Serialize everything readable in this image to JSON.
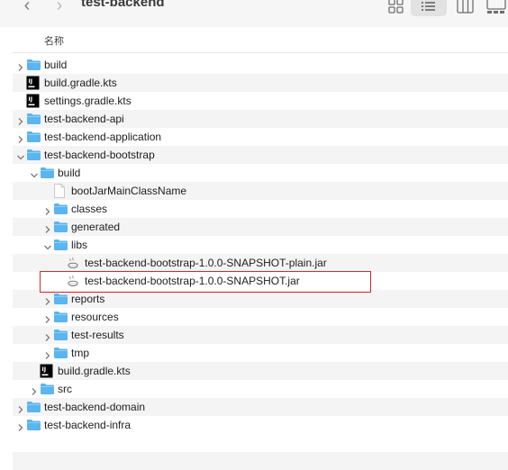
{
  "toolbar": {
    "back_glyph": "‹",
    "forward_glyph": "›",
    "title": "test-backend",
    "views": [
      {
        "name": "icon-view",
        "icon": "grid-icon"
      },
      {
        "name": "list-view",
        "icon": "list-icon",
        "selected": true
      },
      {
        "name": "column-view",
        "icon": "columns-icon"
      },
      {
        "name": "gallery-view",
        "icon": "gallery-icon"
      }
    ]
  },
  "header": {
    "name_column": "名称"
  },
  "colors": {
    "folder": "#5ab5f0",
    "selection_outline": "#d8272b",
    "alt_row": "#f4f4f5"
  },
  "files": [
    {
      "name": "build",
      "depth": 0,
      "kind": "folder",
      "disclosure": "collapsed"
    },
    {
      "name": "build.gradle.kts",
      "depth": 0,
      "kind": "intellij-file"
    },
    {
      "name": "settings.gradle.kts",
      "depth": 0,
      "kind": "intellij-file"
    },
    {
      "name": "test-backend-api",
      "depth": 0,
      "kind": "folder",
      "disclosure": "collapsed"
    },
    {
      "name": "test-backend-application",
      "depth": 0,
      "kind": "folder",
      "disclosure": "collapsed"
    },
    {
      "name": "test-backend-bootstrap",
      "depth": 0,
      "kind": "folder",
      "disclosure": "expanded"
    },
    {
      "name": "build",
      "depth": 1,
      "kind": "folder",
      "disclosure": "expanded"
    },
    {
      "name": "bootJarMainClassName",
      "depth": 2,
      "kind": "document"
    },
    {
      "name": "classes",
      "depth": 2,
      "kind": "folder",
      "disclosure": "collapsed"
    },
    {
      "name": "generated",
      "depth": 2,
      "kind": "folder",
      "disclosure": "collapsed"
    },
    {
      "name": "libs",
      "depth": 2,
      "kind": "folder",
      "disclosure": "expanded"
    },
    {
      "name": "test-backend-bootstrap-1.0.0-SNAPSHOT-plain.jar",
      "depth": 3,
      "kind": "jar-file"
    },
    {
      "name": "test-backend-bootstrap-1.0.0-SNAPSHOT.jar",
      "depth": 3,
      "kind": "jar-file",
      "highlighted": true
    },
    {
      "name": "reports",
      "depth": 2,
      "kind": "folder",
      "disclosure": "collapsed"
    },
    {
      "name": "resources",
      "depth": 2,
      "kind": "folder",
      "disclosure": "collapsed"
    },
    {
      "name": "test-results",
      "depth": 2,
      "kind": "folder",
      "disclosure": "collapsed"
    },
    {
      "name": "tmp",
      "depth": 2,
      "kind": "folder",
      "disclosure": "collapsed"
    },
    {
      "name": "build.gradle.kts",
      "depth": 1,
      "kind": "intellij-file"
    },
    {
      "name": "src",
      "depth": 1,
      "kind": "folder",
      "disclosure": "collapsed"
    },
    {
      "name": "test-backend-domain",
      "depth": 0,
      "kind": "folder",
      "disclosure": "collapsed"
    },
    {
      "name": "test-backend-infra",
      "depth": 0,
      "kind": "folder",
      "disclosure": "collapsed"
    }
  ]
}
